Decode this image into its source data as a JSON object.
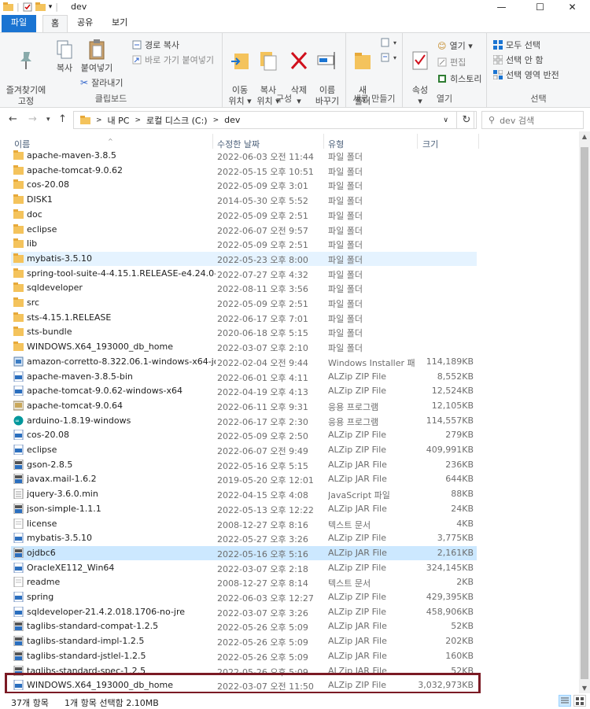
{
  "window": {
    "title": "dev",
    "minimize_glyph": "—",
    "maximize_glyph": "☐",
    "close_glyph": "✕"
  },
  "ribbon_tabs": [
    "파일",
    "홈",
    "공유",
    "보기"
  ],
  "ribbon": {
    "clipboard": {
      "pin": "즐겨찾기에\n고정",
      "copy": "복사",
      "paste": "붙여넣기",
      "copy_path": "경로 복사",
      "paste_shortcut": "바로 가기 붙여넣기",
      "cut": "잘라내기",
      "label": "클립보드"
    },
    "organize": {
      "move_to": "이동\n위치 ▾",
      "copy_to": "복사\n위치 ▾",
      "delete": "삭제\n▾",
      "rename": "이름\n바꾸기",
      "label": "구성"
    },
    "new": {
      "new_folder": "새\n폴더",
      "label": "새로 만들기"
    },
    "open": {
      "properties": "속성\n▾",
      "open": "열기 ▾",
      "edit": "편집",
      "history": "히스토리",
      "label": "열기"
    },
    "select": {
      "select_all": "모두 선택",
      "select_none": "선택 안 함",
      "invert": "선택 영역 반전",
      "label": "선택"
    }
  },
  "address": {
    "crumbs": [
      "내 PC",
      "로컬 디스크 (C:)",
      "dev"
    ],
    "search_placeholder": "dev 검색"
  },
  "columns": {
    "name": "이름",
    "date": "수정한 날짜",
    "type": "유형",
    "size": "크기"
  },
  "files": [
    {
      "name": "apache-maven-3.8.5",
      "date": "2022-06-03 오전 11:44",
      "type": "파일 폴더",
      "size": "",
      "icon": "folder-icon"
    },
    {
      "name": "apache-tomcat-9.0.62",
      "date": "2022-05-15 오후 10:51",
      "type": "파일 폴더",
      "size": "",
      "icon": "folder-icon"
    },
    {
      "name": "cos-20.08",
      "date": "2022-05-09 오후 3:01",
      "type": "파일 폴더",
      "size": "",
      "icon": "folder-icon"
    },
    {
      "name": "DISK1",
      "date": "2014-05-30 오후 5:52",
      "type": "파일 폴더",
      "size": "",
      "icon": "folder-icon"
    },
    {
      "name": "doc",
      "date": "2022-05-09 오후 2:51",
      "type": "파일 폴더",
      "size": "",
      "icon": "folder-icon"
    },
    {
      "name": "eclipse",
      "date": "2022-06-07 오전 9:57",
      "type": "파일 폴더",
      "size": "",
      "icon": "folder-icon"
    },
    {
      "name": "lib",
      "date": "2022-05-09 오후 2:51",
      "type": "파일 폴더",
      "size": "",
      "icon": "folder-icon"
    },
    {
      "name": "mybatis-3.5.10",
      "date": "2022-05-23 오후 8:00",
      "type": "파일 폴더",
      "size": "",
      "icon": "folder-icon"
    },
    {
      "name": "spring-tool-suite-4-4.15.1.RELEASE-e4.24.0-win...",
      "date": "2022-07-27 오후 4:32",
      "type": "파일 폴더",
      "size": "",
      "icon": "folder-icon"
    },
    {
      "name": "sqldeveloper",
      "date": "2022-08-11 오후 3:56",
      "type": "파일 폴더",
      "size": "",
      "icon": "folder-icon"
    },
    {
      "name": "src",
      "date": "2022-05-09 오후 2:51",
      "type": "파일 폴더",
      "size": "",
      "icon": "folder-icon"
    },
    {
      "name": "sts-4.15.1.RELEASE",
      "date": "2022-06-17 오후 7:01",
      "type": "파일 폴더",
      "size": "",
      "icon": "folder-icon"
    },
    {
      "name": "sts-bundle",
      "date": "2020-06-18 오후 5:15",
      "type": "파일 폴더",
      "size": "",
      "icon": "folder-icon"
    },
    {
      "name": "WINDOWS.X64_193000_db_home",
      "date": "2022-03-07 오후 2:10",
      "type": "파일 폴더",
      "size": "",
      "icon": "folder-icon"
    },
    {
      "name": "amazon-corretto-8.322.06.1-windows-x64-jdk",
      "date": "2022-02-04 오전 9:44",
      "type": "Windows Installer 패...",
      "size": "114,189KB",
      "icon": "installer-icon"
    },
    {
      "name": "apache-maven-3.8.5-bin",
      "date": "2022-06-01 오후 4:11",
      "type": "ALZip ZIP File",
      "size": "8,552KB",
      "icon": "zip-icon"
    },
    {
      "name": "apache-tomcat-9.0.62-windows-x64",
      "date": "2022-04-19 오후 4:13",
      "type": "ALZip ZIP File",
      "size": "12,524KB",
      "icon": "zip-icon"
    },
    {
      "name": "apache-tomcat-9.0.64",
      "date": "2022-06-11 오후 9:31",
      "type": "응용 프로그램",
      "size": "12,105KB",
      "icon": "app-icon"
    },
    {
      "name": "arduino-1.8.19-windows",
      "date": "2022-06-17 오후 2:30",
      "type": "응용 프로그램",
      "size": "114,557KB",
      "icon": "arduino-icon"
    },
    {
      "name": "cos-20.08",
      "date": "2022-05-09 오후 2:50",
      "type": "ALZip ZIP File",
      "size": "279KB",
      "icon": "zip-icon"
    },
    {
      "name": "eclipse",
      "date": "2022-06-07 오전 9:49",
      "type": "ALZip ZIP File",
      "size": "409,991KB",
      "icon": "zip-icon"
    },
    {
      "name": "gson-2.8.5",
      "date": "2022-05-16 오후 5:15",
      "type": "ALZip JAR File",
      "size": "236KB",
      "icon": "jar-icon"
    },
    {
      "name": "javax.mail-1.6.2",
      "date": "2019-05-20 오후 12:01",
      "type": "ALZip JAR File",
      "size": "644KB",
      "icon": "jar-icon"
    },
    {
      "name": "jquery-3.6.0.min",
      "date": "2022-04-15 오후 4:08",
      "type": "JavaScript 파일",
      "size": "88KB",
      "icon": "js-icon"
    },
    {
      "name": "json-simple-1.1.1",
      "date": "2022-05-13 오후 12:22",
      "type": "ALZip JAR File",
      "size": "24KB",
      "icon": "jar-icon"
    },
    {
      "name": "license",
      "date": "2008-12-27 오후 8:16",
      "type": "텍스트 문서",
      "size": "4KB",
      "icon": "text-icon"
    },
    {
      "name": "mybatis-3.5.10",
      "date": "2022-05-27 오후 3:26",
      "type": "ALZip ZIP File",
      "size": "3,775KB",
      "icon": "zip-icon"
    },
    {
      "name": "ojdbc6",
      "date": "2022-05-16 오후 5:16",
      "type": "ALZip JAR File",
      "size": "2,161KB",
      "icon": "jar-icon"
    },
    {
      "name": "OracleXE112_Win64",
      "date": "2022-03-07 오후 2:18",
      "type": "ALZip ZIP File",
      "size": "324,145KB",
      "icon": "zip-icon"
    },
    {
      "name": "readme",
      "date": "2008-12-27 오후 8:14",
      "type": "텍스트 문서",
      "size": "2KB",
      "icon": "text-icon"
    },
    {
      "name": "spring",
      "date": "2022-06-03 오후 12:27",
      "type": "ALZip ZIP File",
      "size": "429,395KB",
      "icon": "zip-icon"
    },
    {
      "name": "sqldeveloper-21.4.2.018.1706-no-jre",
      "date": "2022-03-07 오후 3:26",
      "type": "ALZip ZIP File",
      "size": "458,906KB",
      "icon": "zip-icon"
    },
    {
      "name": "taglibs-standard-compat-1.2.5",
      "date": "2022-05-26 오후 5:09",
      "type": "ALZip JAR File",
      "size": "52KB",
      "icon": "jar-icon"
    },
    {
      "name": "taglibs-standard-impl-1.2.5",
      "date": "2022-05-26 오후 5:09",
      "type": "ALZip JAR File",
      "size": "202KB",
      "icon": "jar-icon"
    },
    {
      "name": "taglibs-standard-jstlel-1.2.5",
      "date": "2022-05-26 오후 5:09",
      "type": "ALZip JAR File",
      "size": "160KB",
      "icon": "jar-icon"
    },
    {
      "name": "taglibs-standard-spec-1.2.5",
      "date": "2022-05-26 오후 5:09",
      "type": "ALZip JAR File",
      "size": "52KB",
      "icon": "jar-icon"
    },
    {
      "name": "WINDOWS.X64_193000_db_home",
      "date": "2022-03-07 오전 11:50",
      "type": "ALZip ZIP File",
      "size": "3,032,973KB",
      "icon": "zip-icon"
    }
  ],
  "hover_index": 7,
  "selected_index": 27,
  "status": {
    "count": "37개 항목",
    "selection": "1개 항목 선택함 2.10MB"
  },
  "colors": {
    "accent": "#1a74d2",
    "highlight_box": "#7b1a24",
    "selected_row": "#cce8ff",
    "hover_row": "#e5f3ff",
    "folder": "#f4c35c"
  }
}
